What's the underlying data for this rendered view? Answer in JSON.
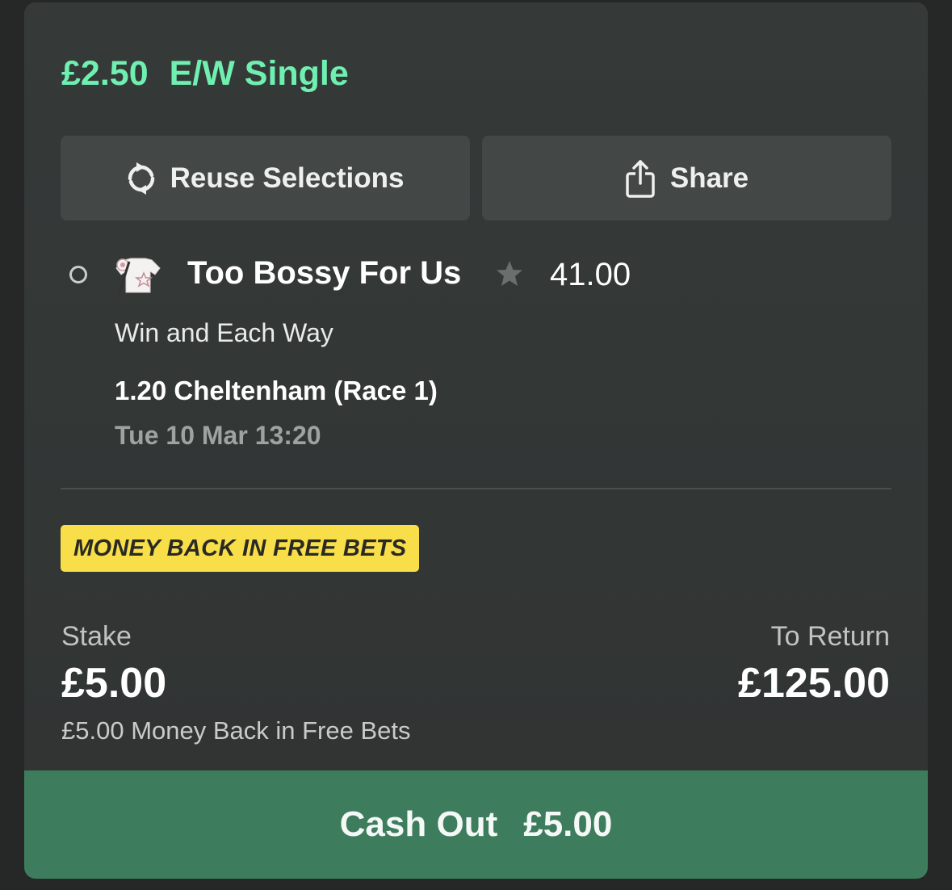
{
  "bet": {
    "stake_amount": "£2.50",
    "bet_type": "E/W Single"
  },
  "actions": {
    "reuse_label": "Reuse Selections",
    "share_label": "Share"
  },
  "selection": {
    "horse": "Too Bossy For Us",
    "odds": "41.00",
    "market": "Win and Each Way",
    "race": "1.20 Cheltenham (Race 1)",
    "datetime": "Tue 10 Mar 13:20"
  },
  "promo": {
    "badge": "MONEY BACK IN FREE BETS",
    "color": "#f8de48"
  },
  "summary": {
    "stake_label": "Stake",
    "stake_value": "£5.00",
    "stake_note": "£5.00 Money Back in Free Bets",
    "return_label": "To Return",
    "return_value": "£125.00"
  },
  "cashout": {
    "label": "Cash Out",
    "amount": "£5.00",
    "color": "#3d7c5c"
  },
  "icons": {
    "reuse": "refresh-icon",
    "share": "share-icon",
    "silks": "jockey-silks-icon",
    "favourite": "star-icon"
  },
  "colors": {
    "accent": "#6ff0b0",
    "card": "#353a39"
  }
}
